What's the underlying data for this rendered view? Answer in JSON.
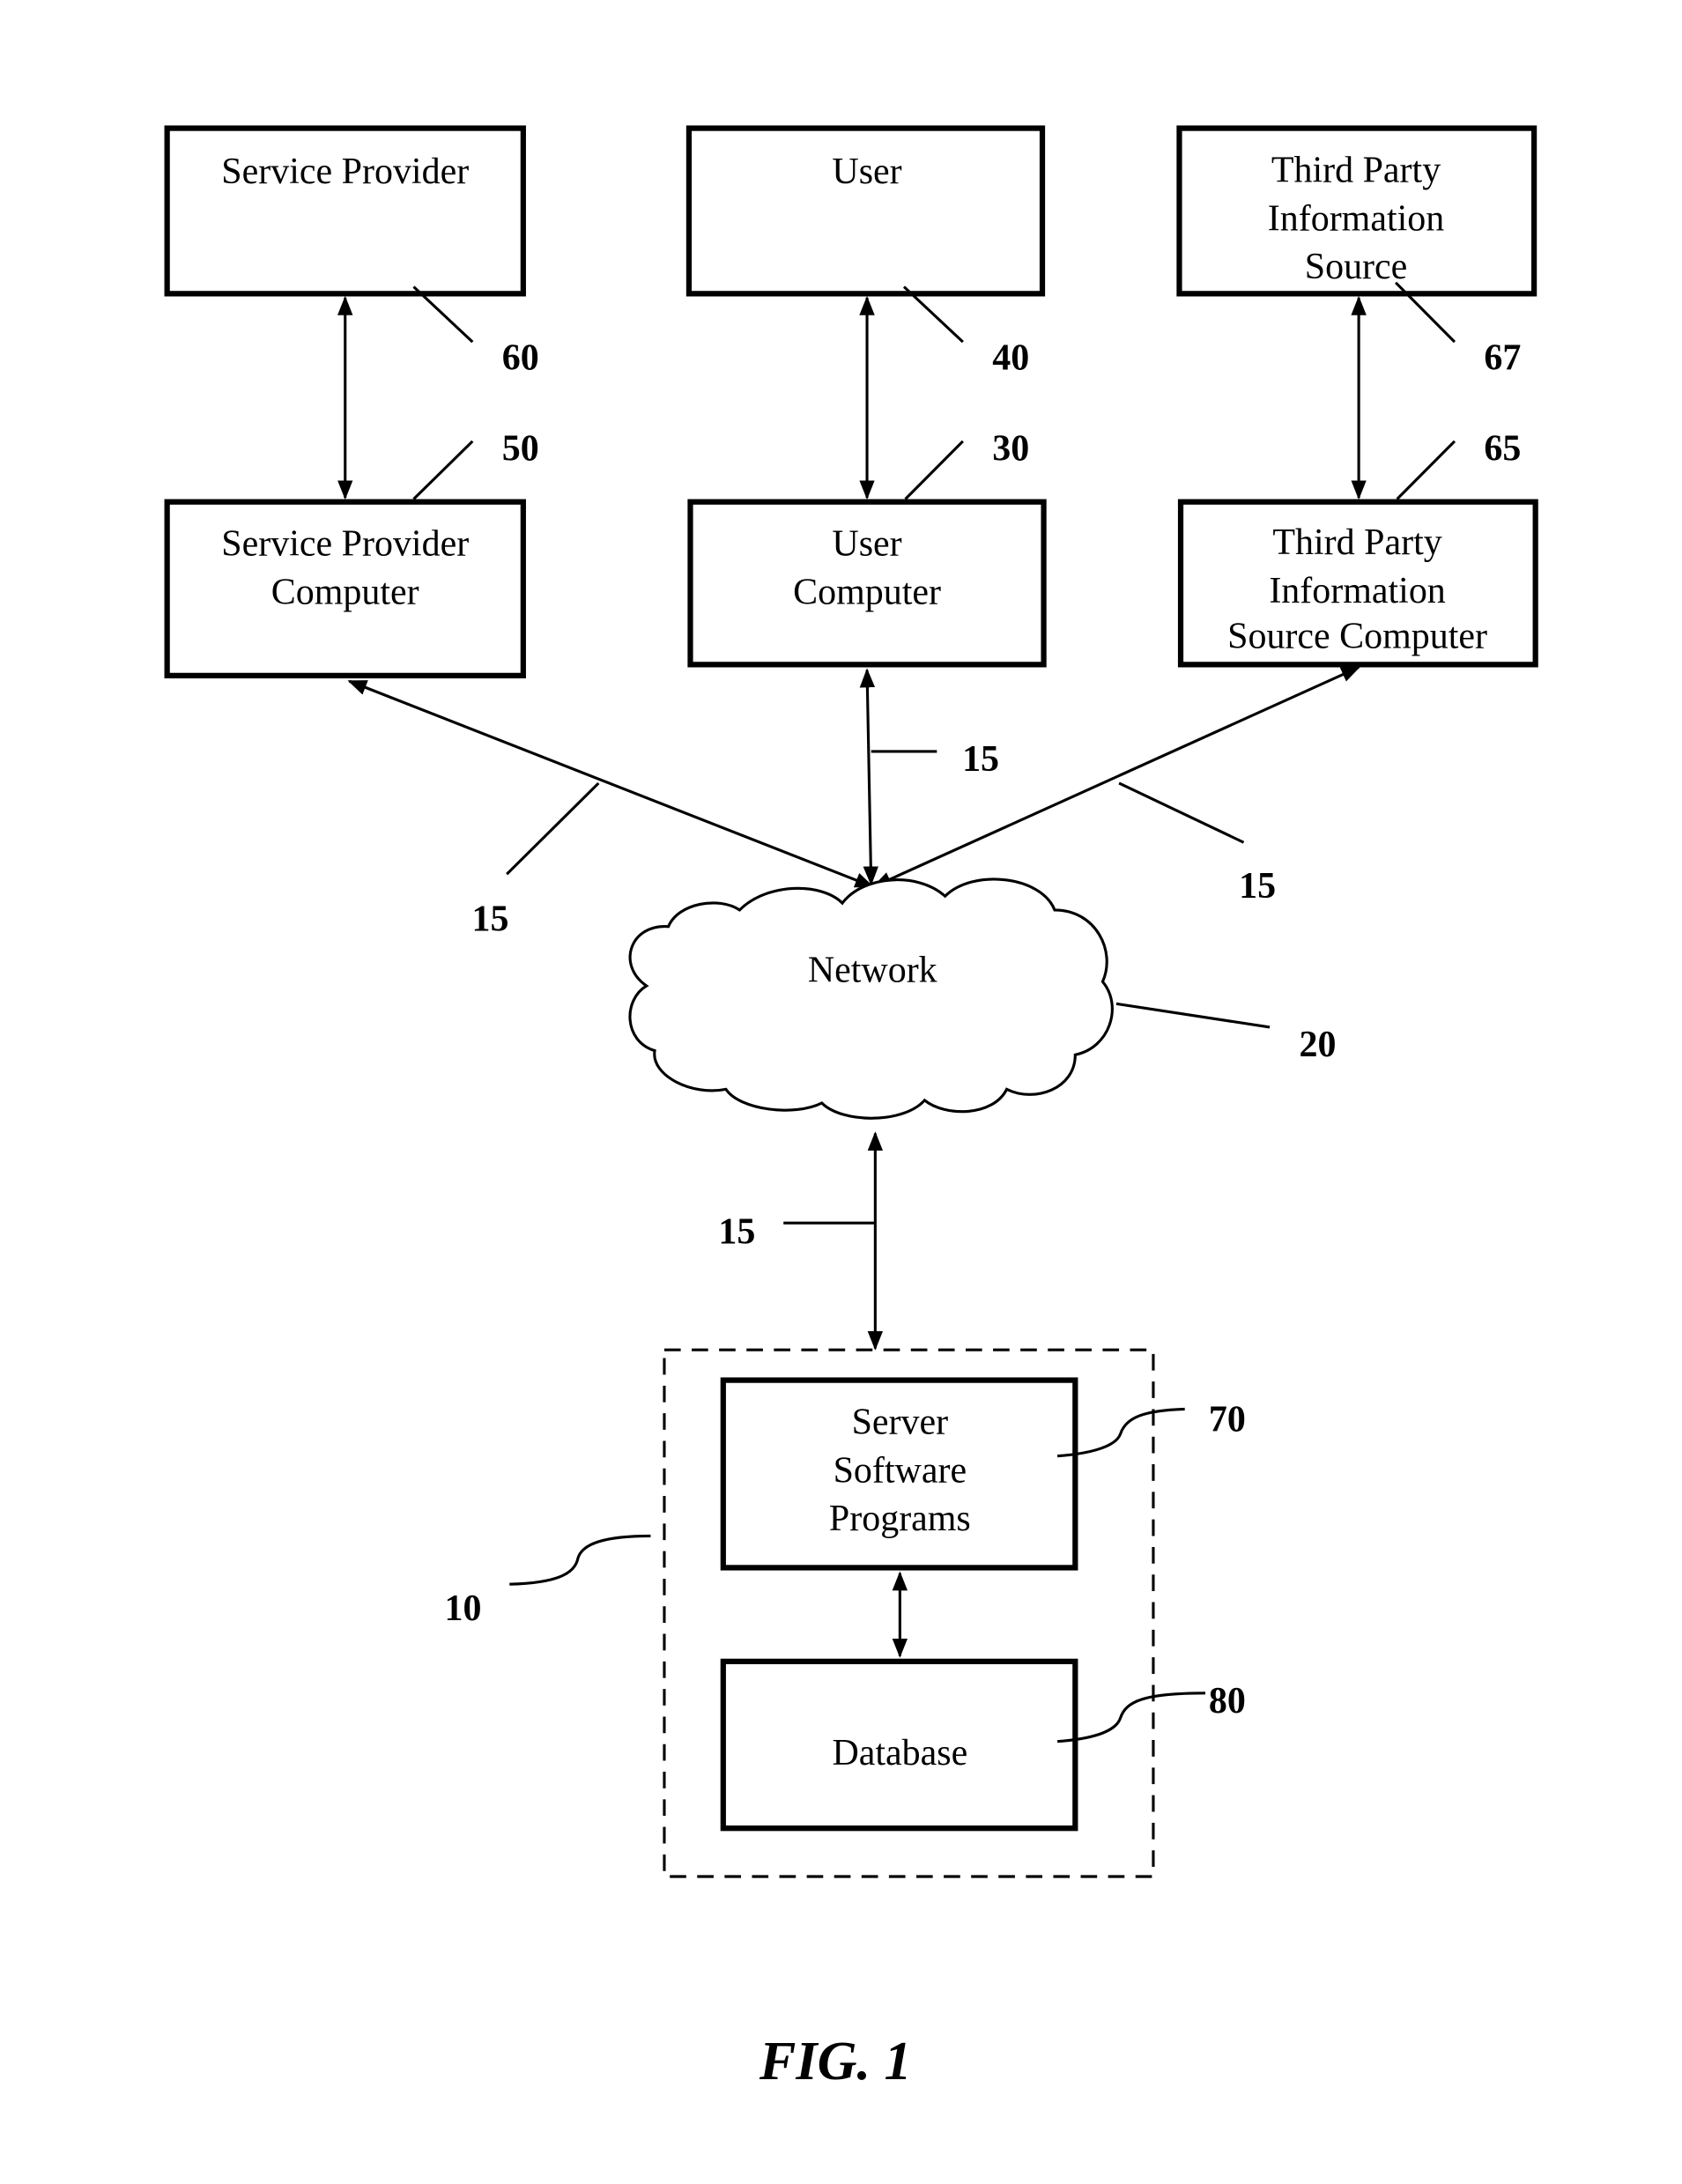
{
  "figure": {
    "caption": "FIG. 1",
    "nodes": {
      "service_provider": {
        "lines": [
          "Service Provider"
        ],
        "ref": "60"
      },
      "user": {
        "lines": [
          "User"
        ],
        "ref": "40"
      },
      "third_party_source": {
        "lines": [
          "Third Party",
          "Information",
          "Source"
        ],
        "ref": "67"
      },
      "service_provider_computer": {
        "lines": [
          "Service Provider",
          "Computer"
        ],
        "ref": "50"
      },
      "user_computer": {
        "lines": [
          "User",
          "Computer"
        ],
        "ref": "30"
      },
      "third_party_source_computer": {
        "lines": [
          "Third Party",
          "Information",
          "Source Computer"
        ],
        "ref": "65"
      },
      "network": {
        "lines": [
          "Network"
        ],
        "ref": "20"
      },
      "server_software": {
        "lines": [
          "Server",
          "Software",
          "Programs"
        ],
        "ref": "70"
      },
      "database": {
        "lines": [
          "Database"
        ],
        "ref": "80"
      },
      "server_system": {
        "ref": "10"
      }
    },
    "connection_ref": "15"
  }
}
